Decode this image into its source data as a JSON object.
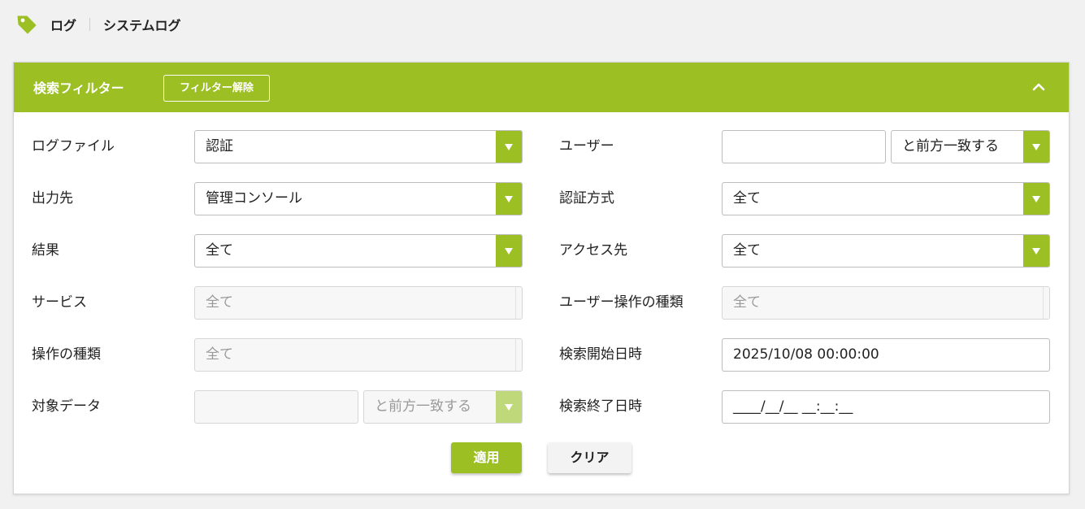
{
  "breadcrumb": {
    "items": [
      "ログ",
      "システムログ"
    ],
    "icon": "tag-icon"
  },
  "colors": {
    "accent": "#9cbf24",
    "accent_faded": "#bfd97a",
    "page_bg": "#f1f1f1"
  },
  "filter_panel": {
    "title": "検索フィルター",
    "clear_filter_label": "フィルター解除",
    "collapse_icon": "chevron-up-icon"
  },
  "left_fields": {
    "log_file": {
      "label": "ログファイル",
      "value": "認証"
    },
    "output_target": {
      "label": "出力先",
      "value": "管理コンソール"
    },
    "result": {
      "label": "結果",
      "value": "全て"
    },
    "service": {
      "label": "サービス",
      "value": "全て"
    },
    "operation_type": {
      "label": "操作の種類",
      "value": "全て"
    },
    "target_data": {
      "label": "対象データ",
      "value": "",
      "match": "と前方一致する"
    }
  },
  "right_fields": {
    "user": {
      "label": "ユーザー",
      "value": "",
      "match": "と前方一致する"
    },
    "auth_method": {
      "label": "認証方式",
      "value": "全て"
    },
    "access_target": {
      "label": "アクセス先",
      "value": "全て"
    },
    "user_operation_type": {
      "label": "ユーザー操作の種類",
      "value": "全て"
    },
    "search_start": {
      "label": "検索開始日時",
      "value": "2025/10/08 00:00:00"
    },
    "search_end": {
      "label": "検索終了日時",
      "value": "____/__/__ __:__:__"
    }
  },
  "buttons": {
    "apply": "適用",
    "clear": "クリア"
  }
}
